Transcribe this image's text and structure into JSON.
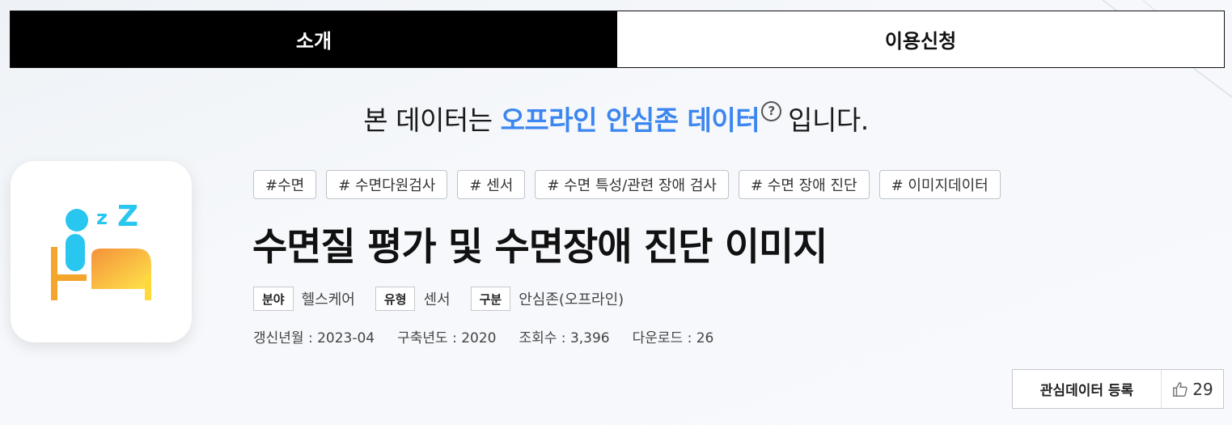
{
  "tabs": [
    {
      "label": "소개",
      "active": true
    },
    {
      "label": "이용신청",
      "active": false
    }
  ],
  "notice": {
    "prefix": "본 데이터는 ",
    "highlight": "오프라인 안심존 데이터",
    "help_icon": "question-circle-icon",
    "suffix": "입니다."
  },
  "thumbnail": {
    "icon": "sleeping-person-bed-icon",
    "colors": {
      "person": "#29c6ef",
      "zz": "#29c6ef",
      "bed": "#f4a62c",
      "blanket_top": "#f4923a",
      "blanket_bottom": "#ffe44a"
    }
  },
  "tags": [
    "#수면",
    "# 수면다원검사",
    "# 센서",
    "# 수면 특성/관련 장애 검사",
    "# 수면 장애 진단",
    "# 이미지데이터"
  ],
  "title": "수면질 평가 및 수면장애 진단 이미지",
  "meta": {
    "field_label": "분야",
    "field_value": "헬스케어",
    "type_label": "유형",
    "type_value": "센서",
    "category_label": "구분",
    "category_value": "안심존(오프라인)"
  },
  "stats": {
    "updated": "갱신년월 : 2023-04",
    "built": "구축년도 : 2020",
    "views": "조회수 : 3,396",
    "downloads": "다운로드 : 26"
  },
  "actions": {
    "register_label": "관심데이터 등록",
    "like_icon": "thumbs-up-icon",
    "like_count": "29"
  },
  "colors": {
    "accent": "#3b86f0",
    "tab_active_bg": "#000000"
  }
}
